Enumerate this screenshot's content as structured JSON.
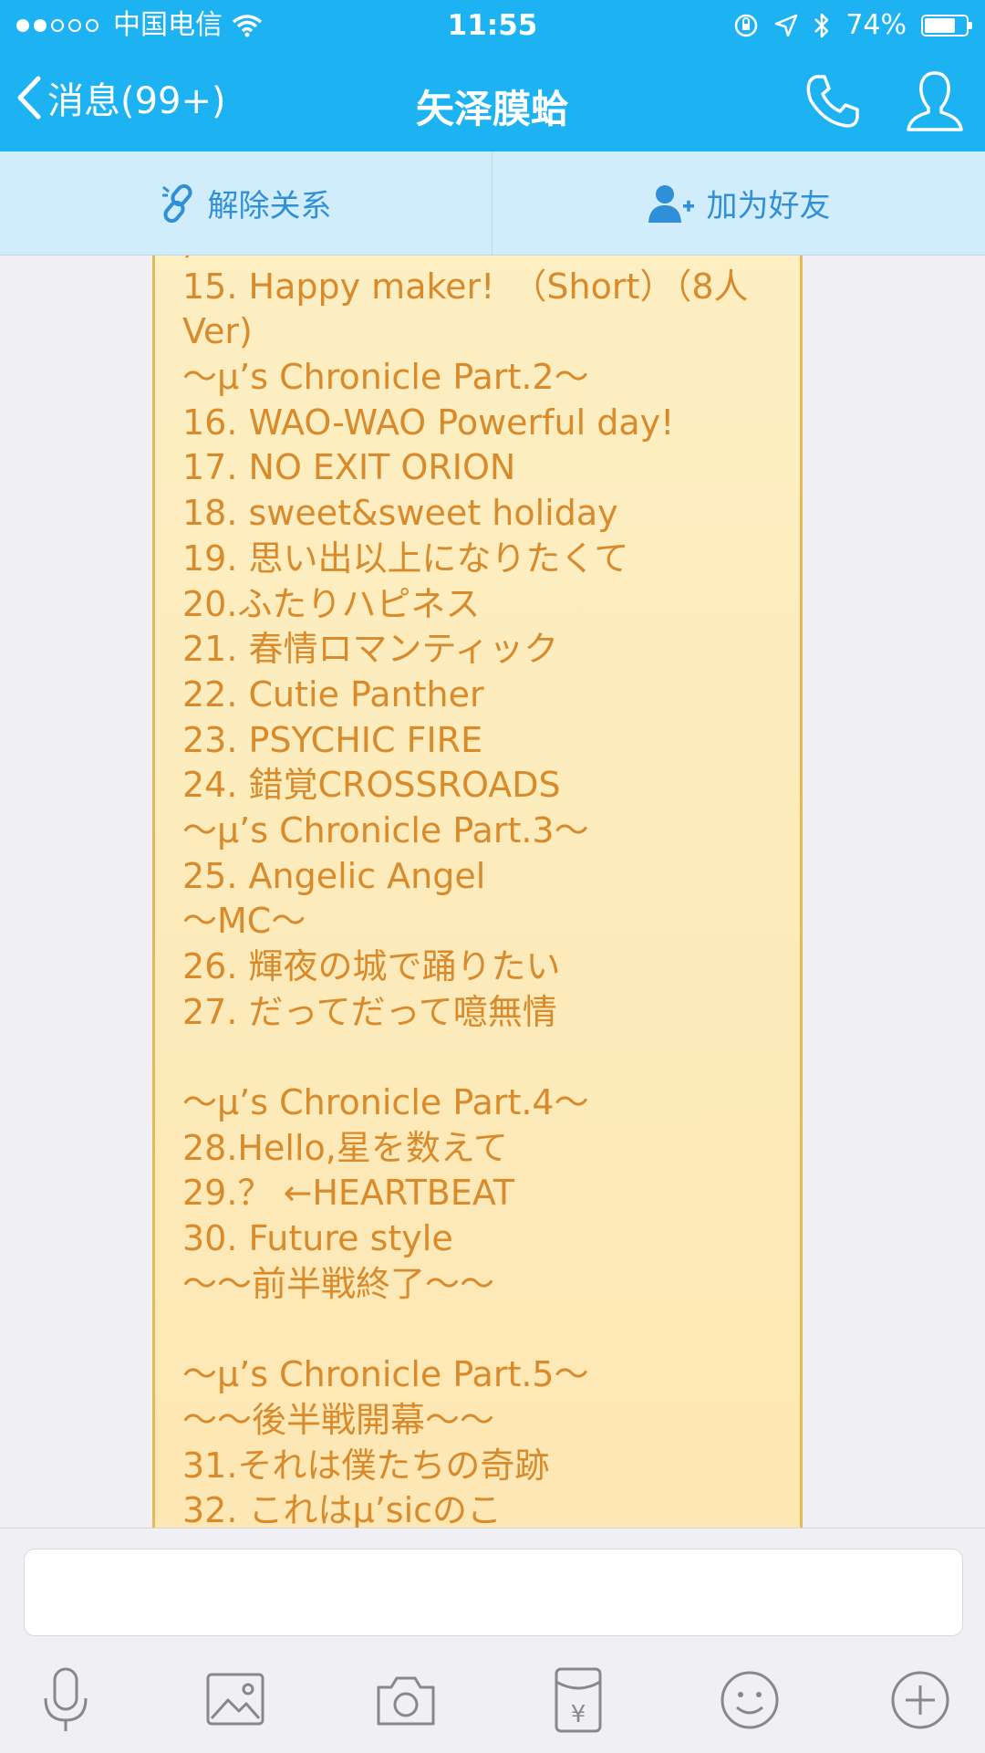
{
  "status_bar": {
    "carrier": "中国电信",
    "time": "11:55",
    "battery": "74%",
    "battery_level": 0.74
  },
  "nav": {
    "back_label": "消息(99+)",
    "title": "矢泽膜蛤",
    "icons": [
      "chevron-left-icon",
      "phone-icon",
      "profile-icon"
    ]
  },
  "actions": {
    "unlink_label": "解除关系",
    "add_friend_label": "加为好友",
    "icons": [
      "unlink-icon",
      "add-friend-icon"
    ]
  },
  "message": {
    "lines": [
      ")",
      "15. Happy maker!　（Short）（8人",
      "Ver)",
      "～μ’s Chronicle Part.2～",
      "16. WAO-WAO Powerful day!",
      "17. NO EXIT ORION",
      "18. sweet&sweet holiday",
      "19. 思い出以上になりたくて",
      "20.ふたりハピネス",
      "21. 春情ロマンティック",
      "22. Cutie Panther",
      "23. PSYCHIC FIRE",
      "24. 錯覚CROSSROADS",
      "～μ’s Chronicle Part.3～",
      "25. Angelic Angel",
      "～MC～",
      "26. 輝夜の城で踊りたい",
      "27. だってだって噫無情",
      "",
      "～μ’s Chronicle Part.4～",
      "28.Hello,星を数えて",
      "29.？ ←HEARTBEAT",
      "30. Future style",
      "～～前半戦終了～～",
      "",
      "～μ’s Chronicle Part.5～",
      "～～後半戦開幕～～",
      "31.それは僕たちの奇跡",
      "32. これはμ’sicのこ"
    ]
  },
  "input": {
    "placeholder": ""
  },
  "toolbar": {
    "icons": [
      "microphone-icon",
      "image-icon",
      "camera-icon",
      "red-packet-icon",
      "emoji-icon",
      "plus-icon"
    ]
  }
}
